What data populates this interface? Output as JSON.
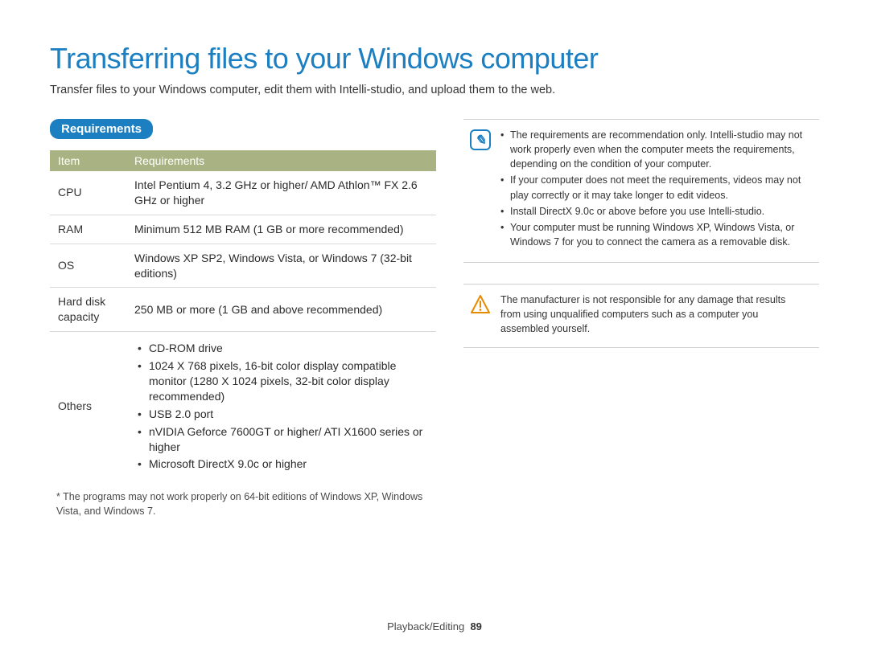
{
  "title": "Transferring files to your Windows computer",
  "intro": "Transfer files to your Windows computer, edit them with Intelli-studio, and upload them to the web.",
  "requirements_heading": "Requirements",
  "table": {
    "headers": {
      "item": "Item",
      "req": "Requirements"
    },
    "rows": {
      "cpu": {
        "label": "CPU",
        "value": "Intel Pentium 4, 3.2 GHz or higher/ AMD Athlon™ FX 2.6 GHz or higher"
      },
      "ram": {
        "label": "RAM",
        "value": "Minimum 512 MB RAM (1 GB or more recommended)"
      },
      "os": {
        "label": "OS",
        "value": "Windows XP SP2, Windows Vista, or Windows 7 (32-bit editions)"
      },
      "hdd": {
        "label": "Hard disk capacity",
        "value": "250 MB or more (1 GB and above recommended)"
      },
      "others": {
        "label": "Others",
        "items": [
          "CD-ROM drive",
          "1024 X 768 pixels, 16-bit color display compatible monitor (1280 X 1024 pixels, 32-bit color display recommended)",
          "USB 2.0 port",
          "nVIDIA Geforce 7600GT or higher/ ATI X1600 series or higher",
          "Microsoft DirectX 9.0c or higher"
        ]
      }
    }
  },
  "footnote": "* The programs may not work properly on 64-bit editions of Windows XP, Windows Vista, and Windows 7.",
  "info_notes": [
    "The requirements are recommendation only. Intelli-studio may not work properly even when the computer meets the requirements, depending on the condition of your computer.",
    "If your computer does not meet the requirements, videos may not play correctly or it may take longer to edit videos.",
    "Install DirectX 9.0c or above before you use Intelli-studio.",
    "Your computer must be running Windows XP, Windows Vista, or Windows 7 for you to connect the camera as a removable disk."
  ],
  "warning_text": "The manufacturer is not responsible for any damage that results from using unqualified computers such as a computer you assembled yourself.",
  "footer": {
    "section": "Playback/Editing",
    "page": "89"
  }
}
